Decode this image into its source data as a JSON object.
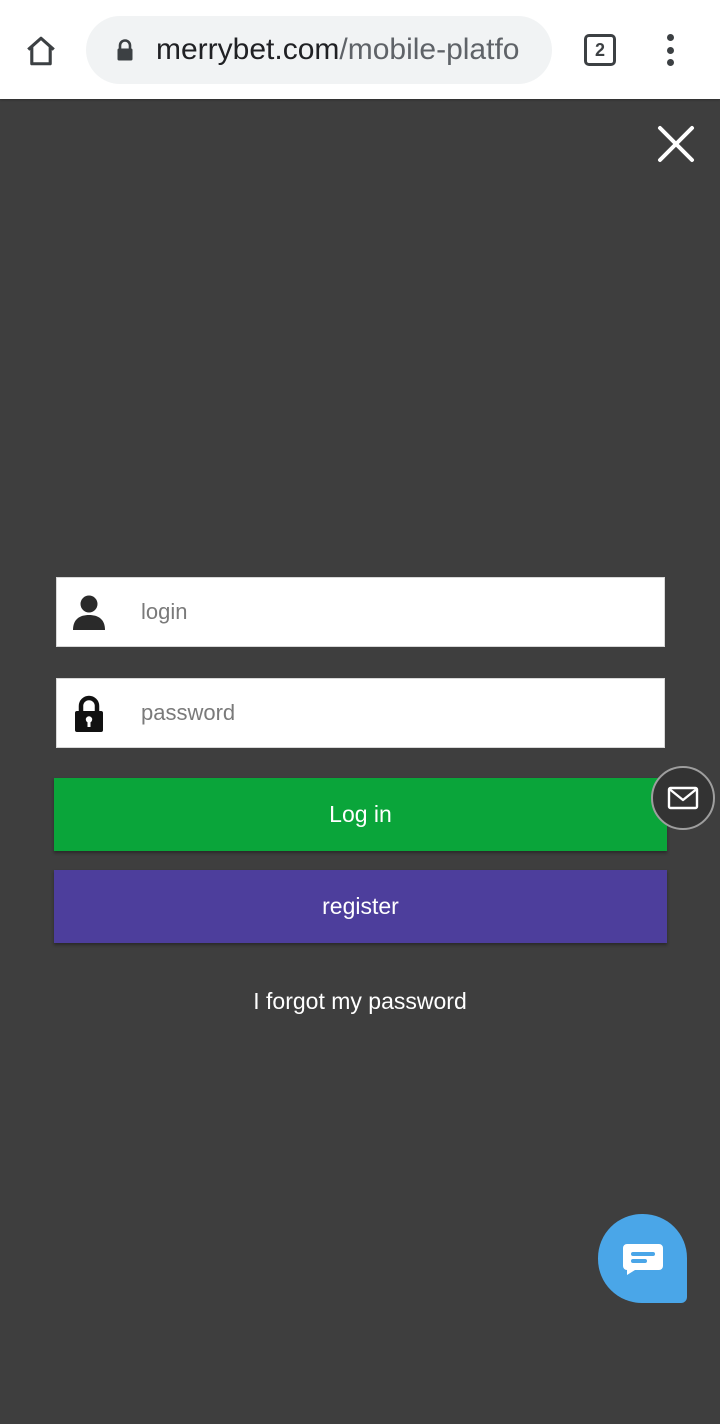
{
  "browser": {
    "url_domain": "merrybet.com",
    "url_path": "/mobile-platfo",
    "tab_count": "2",
    "icons": [
      "home-icon",
      "lock-icon",
      "tabs-icon",
      "more-vert-icon"
    ]
  },
  "login_form": {
    "login_placeholder": "login",
    "login_value": "",
    "password_placeholder": "password",
    "password_value": "",
    "login_button_label": "Log in",
    "register_button_label": "register",
    "forgot_password_label": "I forgot my password"
  },
  "overlay": {
    "icons": [
      "close-icon",
      "mail-icon",
      "chat-icon",
      "user-icon",
      "padlock-icon"
    ]
  },
  "colors": {
    "overlay_background": "#3e3e3e",
    "login_button": "#0aa53a",
    "register_button": "#4d3e9c",
    "chat_button": "#4aa6e8"
  }
}
